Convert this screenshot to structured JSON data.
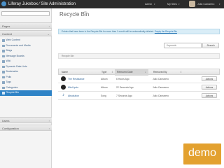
{
  "topbar": {
    "site_title": "Liferay Jukebox ⁄ Site Administration",
    "admin_label": "Admin",
    "mysites_label": "My Sites",
    "user_name": "Julio Camarero",
    "caret": "▾"
  },
  "sidebar": {
    "search_value": "",
    "sections": {
      "pages": "Pages",
      "content": "Content",
      "users": "Users",
      "configuration": "Configuration"
    },
    "chev": "›",
    "chev_open": "⌄",
    "items": [
      {
        "label": "Web Content",
        "active": false
      },
      {
        "label": "Documents and Media",
        "active": false
      },
      {
        "label": "Blogs",
        "active": false
      },
      {
        "label": "Message Boards",
        "active": false
      },
      {
        "label": "Wiki",
        "active": false
      },
      {
        "label": "Dynamic Data Lists",
        "active": false
      },
      {
        "label": "Bookmarks",
        "active": false
      },
      {
        "label": "Polls",
        "active": false
      },
      {
        "label": "Tags",
        "active": false
      },
      {
        "label": "Categories",
        "active": false
      },
      {
        "label": "Recycle Bin",
        "active": true
      }
    ]
  },
  "main": {
    "title": "Recycle Bin",
    "title_help": "(?)",
    "alert_text": "Entries that have been in the Recycle Bin for more than 1 month will be automatically deleted.",
    "alert_link": "Empty the Recycle Bin",
    "search_placeholder": "Keywords",
    "search_button": "Search",
    "breadcrumb": "Recycle Bin",
    "columns": [
      "Name",
      "Type",
      "Removed Date",
      "Removed By"
    ],
    "sort_arrow": "↓",
    "sort_both": "⇕",
    "rows": [
      {
        "name": "The Resistance",
        "type": "Album",
        "date": "6 Hours Ago",
        "by": "Julio Camarero",
        "action": "Actions"
      },
      {
        "name": "Mia Kyoto",
        "type": "Album",
        "date": "22 Seconds Ago",
        "by": "Julio Camarero",
        "action": "Actions"
      },
      {
        "name": "Absolution",
        "type": "Song",
        "date": "7 Seconds Ago",
        "by": "Julio Camarero",
        "action": "Actions"
      }
    ],
    "note_icon": "♪"
  },
  "badge": "demo",
  "colors": {
    "accent": "#2f83c6",
    "topbar": "#2b2b2b",
    "badge": "#e3a12f"
  }
}
